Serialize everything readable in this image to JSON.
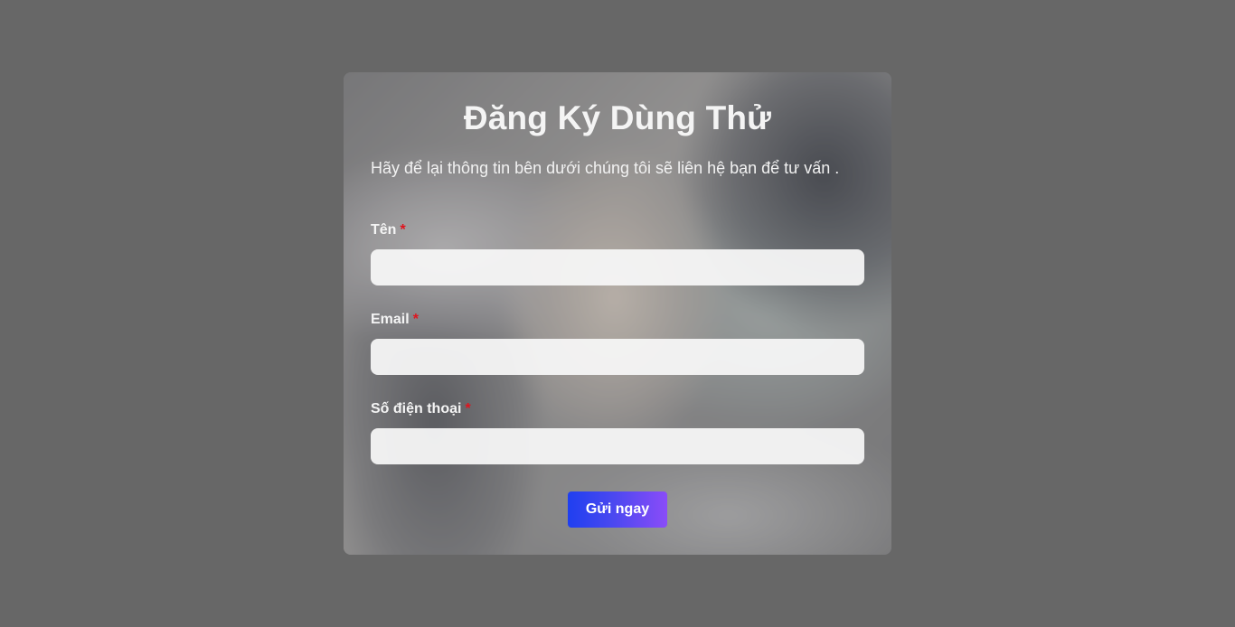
{
  "form": {
    "title": "Đăng Ký Dùng Thử",
    "subtitle": "Hãy để lại thông tin bên dưới chúng tôi sẽ liên hệ bạn để tư vấn .",
    "required_marker": "*",
    "fields": [
      {
        "label": "Tên",
        "value": "",
        "placeholder": ""
      },
      {
        "label": "Email",
        "value": "",
        "placeholder": ""
      },
      {
        "label": "Số điện thoại",
        "value": "",
        "placeholder": ""
      }
    ],
    "submit_label": "Gửi ngay"
  },
  "colors": {
    "page_background": "#676767",
    "required_marker": "#e0141e",
    "button_gradient_start": "#1f3ff0",
    "button_gradient_end": "#8a4cf8"
  }
}
